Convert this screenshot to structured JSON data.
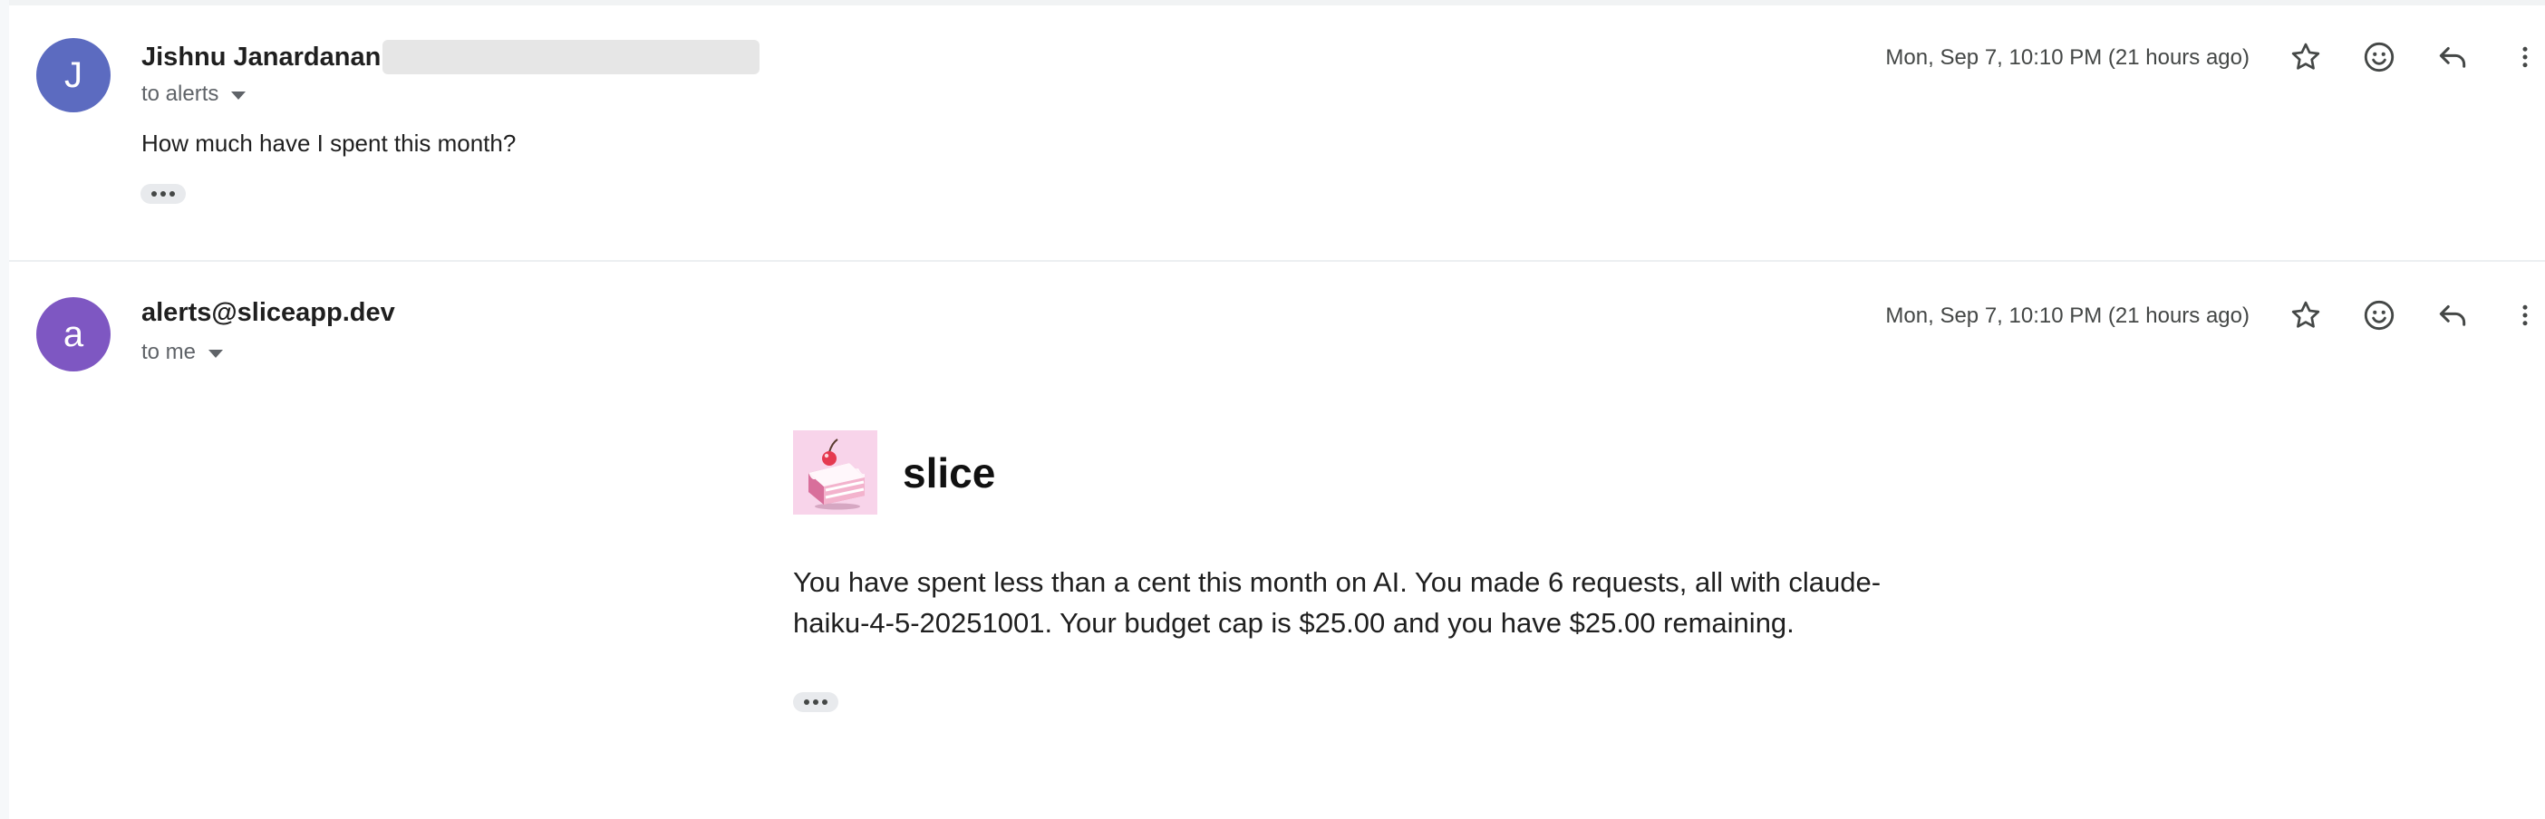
{
  "messages": [
    {
      "avatar_letter": "J",
      "avatar_color": "#5c6bc0",
      "sender": "Jishnu Janardanan",
      "recipient": "to alerts",
      "timestamp": "Mon, Sep 7, 10:10 PM (21 hours ago)",
      "snippet": "How much have I spent this month?"
    },
    {
      "avatar_letter": "a",
      "avatar_color": "#7e57c2",
      "sender": "alerts@sliceapp.dev",
      "recipient": "to me",
      "timestamp": "Mon, Sep 7, 10:10 PM (21 hours ago)",
      "brand_name": "slice",
      "body": "You have spent less than a cent this month on AI. You made 6 requests, all with claude-haiku-4-5-20251001. Your budget cap is $25.00 and you have $25.00 remaining."
    }
  ],
  "icons": {
    "star": "star-icon",
    "emoji": "emoji-icon",
    "reply": "reply-icon",
    "more": "more-vert-icon",
    "logo": "cake-slice-icon"
  },
  "colors": {
    "logo_background": "#f8d4ea",
    "redacted": "#e6e6e6"
  }
}
